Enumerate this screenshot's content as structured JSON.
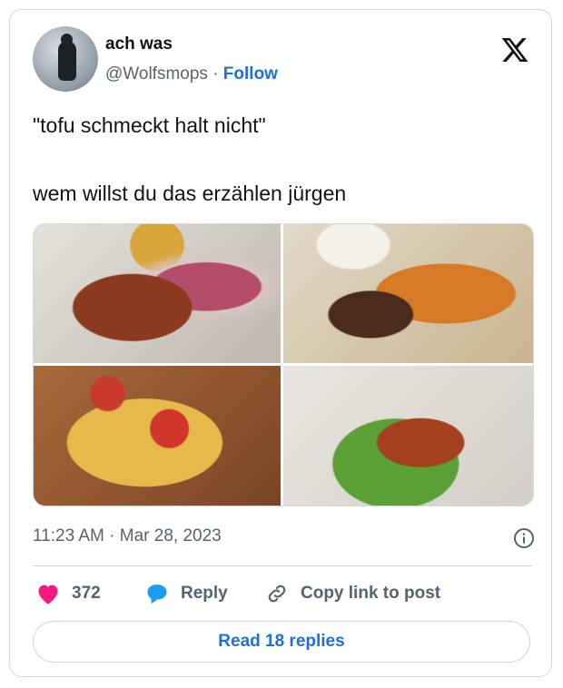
{
  "author": {
    "name": "ach was",
    "handle": "@Wolfsmops",
    "separator": "·",
    "follow_label": "Follow"
  },
  "tweet": {
    "line1": "\"tofu schmeckt halt nicht\"",
    "line2": "wem willst du das erzählen jürgen"
  },
  "timestamp": "11:23 AM · Mar 28, 2023",
  "actions": {
    "like_count": "372",
    "reply_label": "Reply",
    "copy_link_label": "Copy link to post"
  },
  "read_replies_label": "Read 18 replies",
  "colors": {
    "accent": "#1d6fd9",
    "like": "#f91880",
    "muted": "#536471",
    "border": "#cfd9de"
  },
  "icons": {
    "logo": "x-logo-icon",
    "info": "info-icon",
    "like": "heart-icon",
    "reply": "speech-bubble-icon",
    "copy": "link-icon"
  }
}
